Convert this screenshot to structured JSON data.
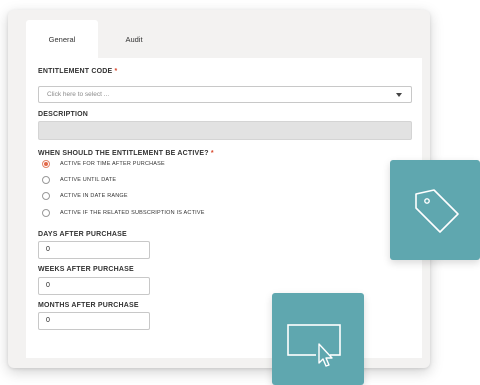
{
  "tabs": [
    {
      "label": "General",
      "active": true
    },
    {
      "label": "Audit",
      "active": false
    }
  ],
  "entitlement_code": {
    "label": "ENTITLEMENT CODE",
    "required_marker": "*",
    "placeholder": "Click here to select ..."
  },
  "description": {
    "label": "DESCRIPTION",
    "value": ""
  },
  "active_period": {
    "label": "WHEN SHOULD THE ENTITLEMENT BE ACTIVE?",
    "required_marker": "*",
    "options": [
      {
        "label": "ACTIVE FOR TIME AFTER PURCHASE",
        "checked": true
      },
      {
        "label": "ACTIVE UNTIL DATE",
        "checked": false
      },
      {
        "label": "ACTIVE IN DATE RANGE",
        "checked": false
      },
      {
        "label": "ACTIVE IF THE RELATED SUBSCRIPTION IS ACTIVE",
        "checked": false
      }
    ]
  },
  "days_after_purchase": {
    "label": "DAYS AFTER PURCHASE",
    "value": "0"
  },
  "weeks_after_purchase": {
    "label": "WEEKS AFTER PURCHASE",
    "value": "0"
  },
  "months_after_purchase": {
    "label": "MONTHS AFTER PURCHASE",
    "value": "0"
  },
  "colors": {
    "accent": "#e36a4a",
    "tile": "#5fa7af"
  },
  "icons": [
    "tag-icon",
    "cursor-select-icon",
    "chevron-down-icon"
  ]
}
